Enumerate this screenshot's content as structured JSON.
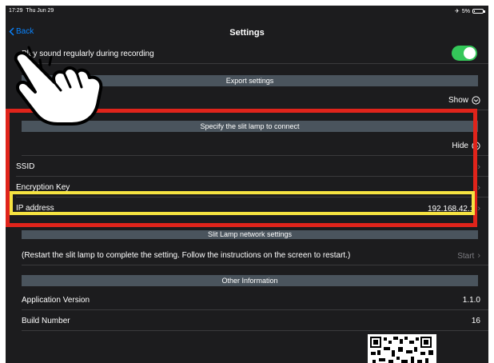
{
  "status_bar": {
    "time": "17:29",
    "date": "Thu Jun 29",
    "battery": "5%"
  },
  "nav": {
    "back_label": "Back",
    "title": "Settings"
  },
  "rows": {
    "sound": "Play sound regularly during recording",
    "export_header": "Export settings",
    "export_toggle": "Show",
    "slit_header": "Specify the slit lamp to connect",
    "slit_toggle": "Hide",
    "ssid": "SSID",
    "encryption": "Encryption Key",
    "ip_label": "IP address",
    "ip_value": "192.168.42.1",
    "network_header": "Slit Lamp network settings",
    "restart_text": "(Restart the slit lamp to complete the setting. Follow the instructions on the screen to restart.)",
    "start_label": "Start",
    "other_header": "Other Information",
    "app_version_label": "Application Version",
    "app_version_value": "1.1.0",
    "build_label": "Build Number",
    "build_value": "16"
  },
  "colors": {
    "accent": "#0a84ff",
    "toggle_on": "#34c759",
    "highlight_red": "#e0241b",
    "highlight_yellow": "#f5e341"
  }
}
